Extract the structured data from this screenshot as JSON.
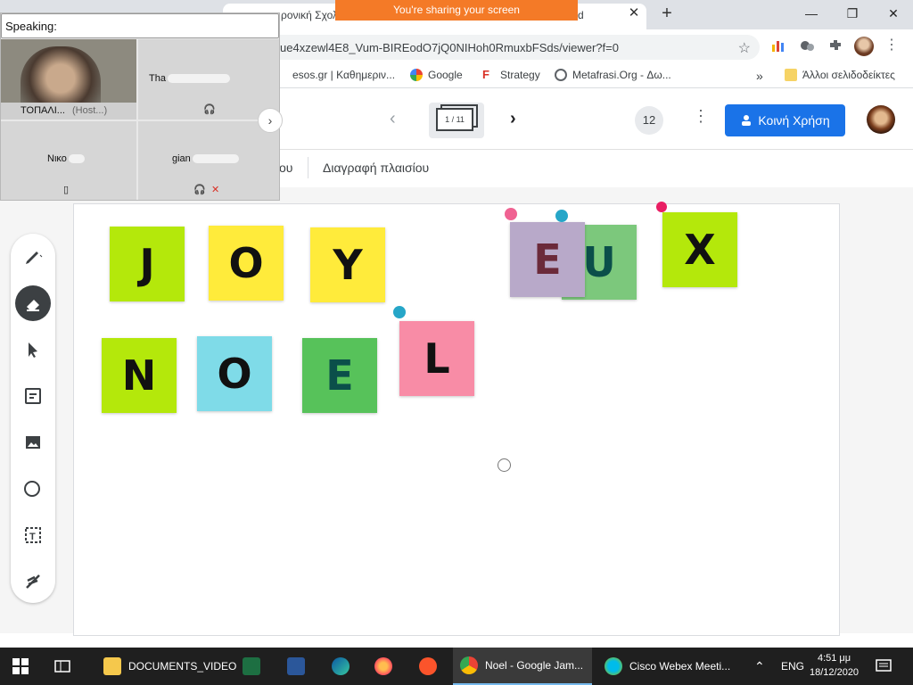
{
  "sharing_banner": "You're sharing your screen",
  "browser": {
    "tab_partial_left": "ρονική Σχολ",
    "tab_partial_right": "d",
    "url": "ue4xzewl4E8_Vum-BIREodO7jQ0NIHoh0RmuxbFSds/viewer?f=0",
    "bookmarks": [
      {
        "label": "esos.gr | Καθημεριν..."
      },
      {
        "label": "Google"
      },
      {
        "label": "Strategy"
      },
      {
        "label": "Metafrasi.Org - Δω..."
      }
    ],
    "other_bookmarks": "Άλλοι σελιδοδείκτες"
  },
  "jamboard": {
    "frame_indicator": "1 / 11",
    "collaborators_count": "12",
    "share_label": "Κοινή Χρήση",
    "toolbar_fragment": "ου",
    "clear_frame_label": "Διαγραφή πλαισίου",
    "stickies": [
      {
        "letter": "J",
        "color": "#b4e80b",
        "text_color": "#111111"
      },
      {
        "letter": "O",
        "color": "#ffeb3b",
        "text_color": "#111111"
      },
      {
        "letter": "Y",
        "color": "#ffeb3b",
        "text_color": "#111111"
      },
      {
        "letter": "E",
        "color": "#b8a9c9",
        "text_color": "#6b2a3a"
      },
      {
        "letter": "U",
        "color": "#7cc87c",
        "text_color": "#0b4f4a"
      },
      {
        "letter": "X",
        "color": "#b4e80b",
        "text_color": "#111111"
      },
      {
        "letter": "N",
        "color": "#b4e80b",
        "text_color": "#111111"
      },
      {
        "letter": "O",
        "color": "#7fdbe8",
        "text_color": "#111111"
      },
      {
        "letter": "E",
        "color": "#57c25a",
        "text_color": "#0b4f4a"
      },
      {
        "letter": "L",
        "color": "#f88ca6",
        "text_color": "#111111"
      }
    ]
  },
  "webex": {
    "speaking_label": "Speaking:",
    "participants": [
      {
        "name": "ΤΟΠΑΛΙ...",
        "role": "(Host...)"
      },
      {
        "name": "Tha"
      },
      {
        "name": "Νικο"
      },
      {
        "name": "gian"
      }
    ]
  },
  "taskbar": {
    "documents_label": "DOCUMENTS_VIDEO",
    "chrome_label": "Noel - Google Jam...",
    "webex_label": "Cisco Webex Meeti...",
    "language": "ENG",
    "time": "4:51 μμ",
    "date": "18/12/2020"
  }
}
